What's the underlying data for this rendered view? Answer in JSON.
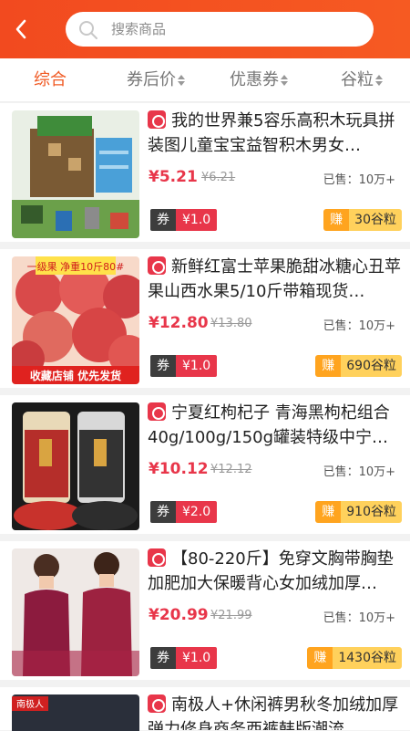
{
  "header": {
    "search_placeholder": "搜索商品"
  },
  "tabs": [
    {
      "label": "综合"
    },
    {
      "label": "券后价"
    },
    {
      "label": "优惠券"
    },
    {
      "label": "谷粒"
    }
  ],
  "products": [
    {
      "title": "我的世界兼5容乐高积木玩具拼装图儿童宝宝益智积木男女…",
      "price": "¥5.21",
      "old_price": "¥6.21",
      "sold": "已售：10万+",
      "coupon_label": "券",
      "coupon_value": "¥1.0",
      "earn_label": "赚",
      "earn_value": "30谷粒"
    },
    {
      "title": "新鲜红富士苹果脆甜冰糖心丑苹果山西水果5/10斤带箱现货…",
      "price": "¥12.80",
      "old_price": "¥13.80",
      "sold": "已售：10万+",
      "coupon_label": "券",
      "coupon_value": "¥1.0",
      "earn_label": "赚",
      "earn_value": "690谷粒",
      "thumb_text": "一级果 净重10斤80#",
      "thumb_bottom_text": "收藏店铺 优先发货"
    },
    {
      "title": "宁夏红枸杞子 青海黑枸杞组合40g/100g/150g罐装特级中宁…",
      "price": "¥10.12",
      "old_price": "¥12.12",
      "sold": "已售：10万+",
      "coupon_label": "券",
      "coupon_value": "¥2.0",
      "earn_label": "赚",
      "earn_value": "910谷粒"
    },
    {
      "title": "【80-220斤】免穿文胸带胸垫加肥加大保暖背心女加绒加厚…",
      "price": "¥20.99",
      "old_price": "¥21.99",
      "sold": "已售：10万+",
      "coupon_label": "券",
      "coupon_value": "¥1.0",
      "earn_label": "赚",
      "earn_value": "1430谷粒"
    },
    {
      "title": "南极人+休闲裤男秋冬加绒加厚弹力修身商务西裤韩版潮流",
      "thumb_text": "南极人"
    }
  ],
  "colors": {
    "header": "#f24a1f",
    "accent": "#f05a24",
    "price": "#e8364a",
    "coupon_dark": "#3d3d3d",
    "earn_orange": "#ffa41f",
    "earn_yellow": "#ffd15c"
  },
  "icons": [
    "back-arrow-icon",
    "search-icon",
    "sort-arrows-icon",
    "shop-badge-icon"
  ]
}
